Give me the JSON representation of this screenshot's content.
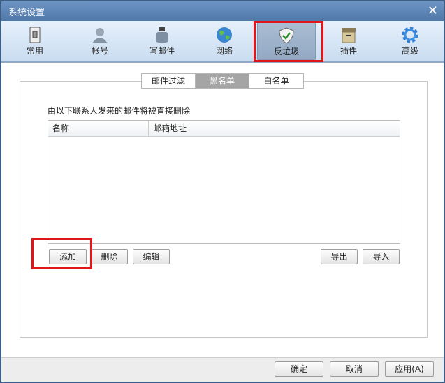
{
  "window": {
    "title": "系统设置"
  },
  "toolbar": {
    "items": [
      {
        "label": "常用",
        "icon": "switch-icon"
      },
      {
        "label": "帐号",
        "icon": "user-icon"
      },
      {
        "label": "写邮件",
        "icon": "ink-bottle-icon"
      },
      {
        "label": "网络",
        "icon": "globe-icon"
      },
      {
        "label": "反垃圾",
        "icon": "shield-check-icon",
        "active": true
      },
      {
        "label": "插件",
        "icon": "box-icon"
      },
      {
        "label": "高级",
        "icon": "gear-icon"
      }
    ]
  },
  "tabs": [
    {
      "label": "邮件过滤"
    },
    {
      "label": "黑名单",
      "active": true
    },
    {
      "label": "白名单"
    }
  ],
  "blacklist": {
    "description": "由以下联系人发来的邮件将被直接删除",
    "columns": [
      "名称",
      "邮箱地址"
    ],
    "rows": [],
    "buttons": {
      "add": "添加",
      "delete": "删除",
      "edit": "编辑",
      "export": "导出",
      "import": "导入"
    }
  },
  "footer": {
    "ok": "确定",
    "cancel": "取消",
    "apply": "应用(A)"
  },
  "highlight_color": "#e0161b"
}
